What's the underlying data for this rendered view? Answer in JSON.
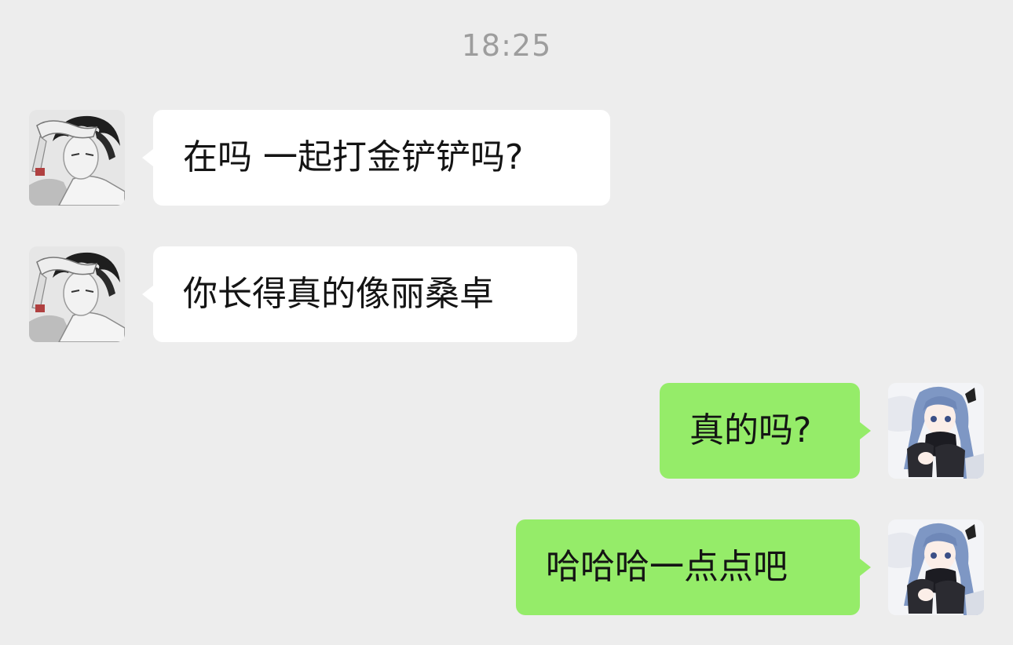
{
  "chat": {
    "timestamp": "18:25",
    "messages": [
      {
        "sender": "contact",
        "text": "在吗 一起打金铲铲吗?",
        "avatar_icon": "contact-avatar-icon"
      },
      {
        "sender": "contact",
        "text": "你长得真的像丽桑卓",
        "avatar_icon": "contact-avatar-icon"
      },
      {
        "sender": "self",
        "text": "真的吗?",
        "avatar_icon": "self-avatar-icon"
      },
      {
        "sender": "self",
        "text": "哈哈哈一点点吧",
        "avatar_icon": "self-avatar-icon"
      }
    ]
  },
  "colors": {
    "background": "#ededed",
    "incoming_bubble": "#ffffff",
    "outgoing_bubble": "#95ec69",
    "timestamp_text": "#9d9d9d",
    "message_text": "#141414"
  }
}
